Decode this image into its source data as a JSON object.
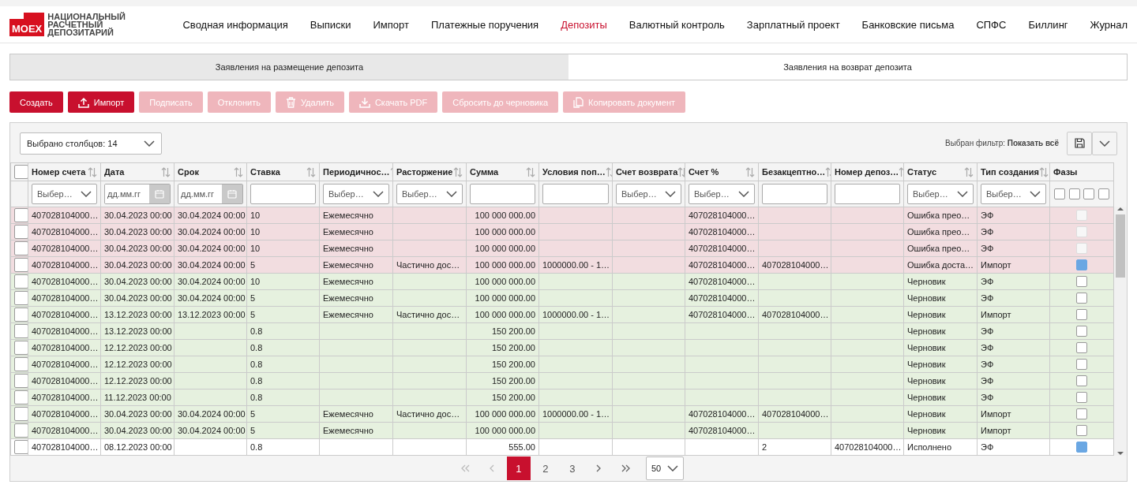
{
  "logo": {
    "mark": "MOEX",
    "lines": [
      "НАЦИОНАЛЬНЫЙ",
      "РАСЧЕТНЫЙ",
      "ДЕПОЗИТАРИЙ"
    ]
  },
  "nav": [
    {
      "label": "Сводная информация",
      "selected": false
    },
    {
      "label": "Выписки",
      "selected": false
    },
    {
      "label": "Импорт",
      "selected": false
    },
    {
      "label": "Платежные поручения",
      "selected": false
    },
    {
      "label": "Депозиты",
      "selected": true
    },
    {
      "label": "Валютный контроль",
      "selected": false
    },
    {
      "label": "Зарплатный проект",
      "selected": false
    },
    {
      "label": "Банковские письма",
      "selected": false
    },
    {
      "label": "СПФС",
      "selected": false
    },
    {
      "label": "Биллинг",
      "selected": false
    },
    {
      "label": "Журнал",
      "selected": false
    }
  ],
  "tabs": [
    {
      "label": "Заявления на размещение депозита",
      "selected": false
    },
    {
      "label": "Заявления на возврат депозита",
      "selected": true
    }
  ],
  "actions": [
    {
      "label": "Создать",
      "disabled": false
    },
    {
      "label": "Импорт",
      "disabled": false
    },
    {
      "label": "Подписать",
      "disabled": true
    },
    {
      "label": "Отклонить",
      "disabled": true
    },
    {
      "label": "Удалить",
      "disabled": true
    },
    {
      "label": "Скачать PDF",
      "disabled": true
    },
    {
      "label": "Сбросить до черновика",
      "disabled": true
    },
    {
      "label": "Копировать документ",
      "disabled": true
    }
  ],
  "grid": {
    "columns_selector": "Выбрано столбцов: 14",
    "filter_label": "Выбран фильтр: **Показать всё**",
    "columns": [
      {
        "title": "Номер счета",
        "sortable": true,
        "filter": {
          "kind": "select",
          "placeholder": "Выбер…"
        }
      },
      {
        "title": "Дата",
        "sortable": true,
        "filter": {
          "kind": "date",
          "placeholder": "дд.мм.гг"
        }
      },
      {
        "title": "Срок",
        "sortable": true,
        "filter": {
          "kind": "date",
          "placeholder": "дд.мм.гг"
        }
      },
      {
        "title": "Ставка",
        "sortable": true,
        "filter": {
          "kind": "text"
        }
      },
      {
        "title": "Периодичнос…",
        "sortable": true,
        "filter": {
          "kind": "select",
          "placeholder": "Выбер…"
        }
      },
      {
        "title": "Расторжение",
        "sortable": true,
        "filter": {
          "kind": "select",
          "placeholder": "Выбер…"
        }
      },
      {
        "title": "Сумма",
        "sortable": true,
        "filter": {
          "kind": "text"
        }
      },
      {
        "title": "Условия поп…",
        "sortable": true,
        "filter": {
          "kind": "text"
        }
      },
      {
        "title": "Счет возврата",
        "sortable": true,
        "filter": {
          "kind": "select",
          "placeholder": "Выбер…"
        }
      },
      {
        "title": "Счет %",
        "sortable": true,
        "filter": {
          "kind": "select",
          "placeholder": "Выбер…"
        }
      },
      {
        "title": "Безакцептно…",
        "sortable": true,
        "filter": {
          "kind": "text"
        }
      },
      {
        "title": "Номер депоз…",
        "sortable": true,
        "filter": {
          "kind": "text"
        }
      },
      {
        "title": "Статус",
        "sortable": true,
        "filter": {
          "kind": "select",
          "placeholder": "Выбер…"
        }
      },
      {
        "title": "Тип создания",
        "sortable": true,
        "filter": {
          "kind": "select",
          "placeholder": "Выбер…"
        }
      },
      {
        "title": "Фазы",
        "sortable": false,
        "filter": {
          "kind": "checks",
          "options": [
            {
              "checked": false
            },
            {
              "checked": false
            },
            {
              "checked": false
            },
            {
              "checked": false
            }
          ]
        }
      }
    ],
    "select_all_checked": false,
    "rows": [
      {
        "color": "#f2dde0",
        "selected": false,
        "phase_checked": false,
        "phase_disabled": true,
        "cells": [
          "407028104000…",
          "30.04.2023 00:00",
          "30.04.2024 00:00",
          "10",
          "Ежемесячно",
          "",
          "100 000 000.00",
          "",
          "",
          "407028104000…",
          "",
          "",
          "Ошибка прео…",
          "ЭФ"
        ]
      },
      {
        "color": "#f2dde0",
        "selected": false,
        "phase_checked": false,
        "phase_disabled": true,
        "cells": [
          "407028104000…",
          "30.04.2023 00:00",
          "30.04.2024 00:00",
          "10",
          "Ежемесячно",
          "",
          "100 000 000.00",
          "",
          "",
          "407028104000…",
          "",
          "",
          "Ошибка прео…",
          "ЭФ"
        ]
      },
      {
        "color": "#f2dde0",
        "selected": false,
        "phase_checked": false,
        "phase_disabled": true,
        "cells": [
          "407028104000…",
          "30.04.2023 00:00",
          "30.04.2024 00:00",
          "10",
          "Ежемесячно",
          "",
          "100 000 000.00",
          "",
          "",
          "407028104000…",
          "",
          "",
          "Ошибка прео…",
          "ЭФ"
        ]
      },
      {
        "color": "#f2dde0",
        "selected": false,
        "phase_checked": true,
        "phase_disabled": false,
        "cells": [
          "407028104000…",
          "30.04.2023 00:00",
          "30.04.2024 00:00",
          "5",
          "Ежемесячно",
          "Частично дос…",
          "100 000 000.00",
          "1000000.00 - 1…",
          "",
          "407028104000…",
          "407028104000…",
          "",
          "Ошибка доста…",
          "Импорт"
        ]
      },
      {
        "color": "#e6f1df",
        "selected": false,
        "phase_checked": false,
        "phase_disabled": false,
        "cells": [
          "407028104000…",
          "30.04.2023 00:00",
          "30.04.2024 00:00",
          "10",
          "Ежемесячно",
          "",
          "100 000 000.00",
          "",
          "",
          "407028104000…",
          "",
          "",
          "Черновик",
          "ЭФ"
        ]
      },
      {
        "color": "#e6f1df",
        "selected": false,
        "phase_checked": false,
        "phase_disabled": false,
        "cells": [
          "407028104000…",
          "30.04.2023 00:00",
          "30.04.2024 00:00",
          "5",
          "Ежемесячно",
          "",
          "100 000 000.00",
          "",
          "",
          "407028104000…",
          "",
          "",
          "Черновик",
          "ЭФ"
        ]
      },
      {
        "color": "#e6f1df",
        "selected": false,
        "phase_checked": false,
        "phase_disabled": false,
        "cells": [
          "407028104000…",
          "13.12.2023 00:00",
          "13.12.2023 00:00",
          "5",
          "Ежемесячно",
          "Частично дос…",
          "100 000 000.00",
          "1000000.00 - 1…",
          "",
          "407028104000…",
          "407028104000…",
          "",
          "Черновик",
          "Импорт"
        ]
      },
      {
        "color": "#e6f1df",
        "selected": false,
        "phase_checked": false,
        "phase_disabled": false,
        "cells": [
          "407028104000…",
          "13.12.2023 00:00",
          "",
          "0.8",
          "",
          "",
          "150 200.00",
          "",
          "",
          "",
          "",
          "",
          "Черновик",
          "ЭФ"
        ]
      },
      {
        "color": "#e6f1df",
        "selected": false,
        "phase_checked": false,
        "phase_disabled": false,
        "cells": [
          "407028104000…",
          "12.12.2023 00:00",
          "",
          "0.8",
          "",
          "",
          "150 200.00",
          "",
          "",
          "",
          "",
          "",
          "Черновик",
          "ЭФ"
        ]
      },
      {
        "color": "#e6f1df",
        "selected": false,
        "phase_checked": false,
        "phase_disabled": false,
        "cells": [
          "407028104000…",
          "12.12.2023 00:00",
          "",
          "0.8",
          "",
          "",
          "150 200.00",
          "",
          "",
          "",
          "",
          "",
          "Черновик",
          "ЭФ"
        ]
      },
      {
        "color": "#e6f1df",
        "selected": false,
        "phase_checked": false,
        "phase_disabled": false,
        "cells": [
          "407028104000…",
          "12.12.2023 00:00",
          "",
          "0.8",
          "",
          "",
          "150 200.00",
          "",
          "",
          "",
          "",
          "",
          "Черновик",
          "ЭФ"
        ]
      },
      {
        "color": "#e6f1df",
        "selected": false,
        "phase_checked": false,
        "phase_disabled": false,
        "cells": [
          "407028104000…",
          "11.12.2023 00:00",
          "",
          "0.8",
          "",
          "",
          "150 200.00",
          "",
          "",
          "",
          "",
          "",
          "Черновик",
          "ЭФ"
        ]
      },
      {
        "color": "#e6f1df",
        "selected": false,
        "phase_checked": false,
        "phase_disabled": false,
        "cells": [
          "407028104000…",
          "30.04.2023 00:00",
          "30.04.2024 00:00",
          "5",
          "Ежемесячно",
          "Частично дос…",
          "100 000 000.00",
          "1000000.00 - 1…",
          "",
          "407028104000…",
          "407028104000…",
          "",
          "Черновик",
          "Импорт"
        ]
      },
      {
        "color": "#e6f1df",
        "selected": false,
        "phase_checked": false,
        "phase_disabled": false,
        "cells": [
          "407028104000…",
          "30.04.2023 00:00",
          "30.04.2024 00:00",
          "5",
          "Ежемесячно",
          "",
          "100 000 000.00",
          "",
          "",
          "407028104000…",
          "",
          "",
          "Черновик",
          "Импорт"
        ]
      },
      {
        "color": "#ffffff",
        "selected": false,
        "phase_checked": true,
        "phase_disabled": false,
        "cells": [
          "407028104000…",
          "08.12.2023 00:00",
          "",
          "0.8",
          "",
          "",
          "555.00",
          "",
          "",
          "",
          "2",
          "407028104000…",
          "Исполнено",
          "ЭФ"
        ]
      }
    ],
    "pager": {
      "pages": [
        {
          "label": "1",
          "selected": true
        },
        {
          "label": "2",
          "selected": false
        },
        {
          "label": "3",
          "selected": false
        }
      ],
      "page_size": "50"
    }
  }
}
